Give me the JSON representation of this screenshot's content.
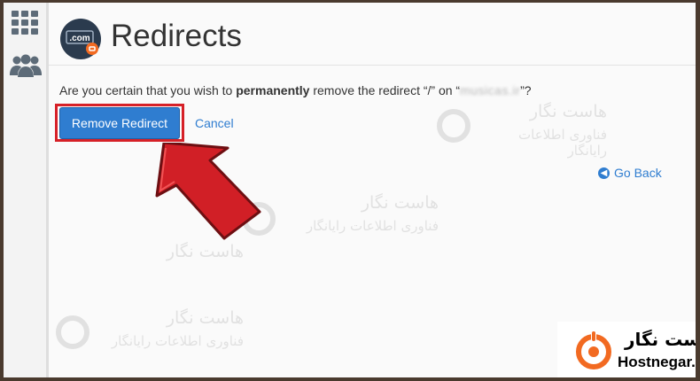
{
  "sidebar": {
    "items": [
      {
        "icon": "grid-icon"
      },
      {
        "icon": "users-icon"
      }
    ]
  },
  "header": {
    "title": "Redirects",
    "icon_text": ".com"
  },
  "confirm": {
    "prefix": "Are you certain that you wish to ",
    "emphasis": "permanently",
    "middle": " remove the redirect “/” on “",
    "domain": "musicas.ir",
    "suffix": "”?"
  },
  "actions": {
    "remove_label": "Remove Redirect",
    "cancel_label": "Cancel",
    "goback_label": "Go Back"
  },
  "watermark": {
    "line1": "هاست نگار",
    "line2": "فناوری اطلاعات رایانگار"
  },
  "brand": {
    "name_fa": "هاست نگار",
    "name_en": "Hostnegar.com"
  },
  "colors": {
    "accent": "#2f7dd0",
    "highlight": "#d62027",
    "brand_orange": "#f26a21"
  }
}
